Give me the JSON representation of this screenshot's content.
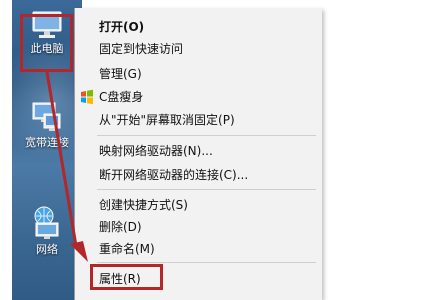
{
  "desktop": {
    "icons": [
      {
        "label": "此电脑",
        "icon": "computer-icon"
      },
      {
        "label": "宽带连接",
        "icon": "network-connection-icon"
      },
      {
        "label": "网络",
        "icon": "network-icon"
      }
    ]
  },
  "context_menu": {
    "items": [
      {
        "label": "打开(O)",
        "bold": true
      },
      {
        "label": "固定到快速访问"
      },
      {
        "label": "管理(G)"
      },
      {
        "label": "C盘瘦身",
        "icon": "windows-flag-icon"
      },
      {
        "label": "从\"开始\"屏幕取消固定(P)"
      },
      {
        "label": "映射网络驱动器(N)..."
      },
      {
        "label": "断开网络驱动器的连接(C)..."
      },
      {
        "label": "创建快捷方式(S)"
      },
      {
        "label": "删除(D)"
      },
      {
        "label": "重命名(M)"
      },
      {
        "label": "属性(R)"
      }
    ]
  },
  "annotation": {
    "highlight_color": "#b3262a",
    "arrow_icon": "red-arrow-icon"
  }
}
